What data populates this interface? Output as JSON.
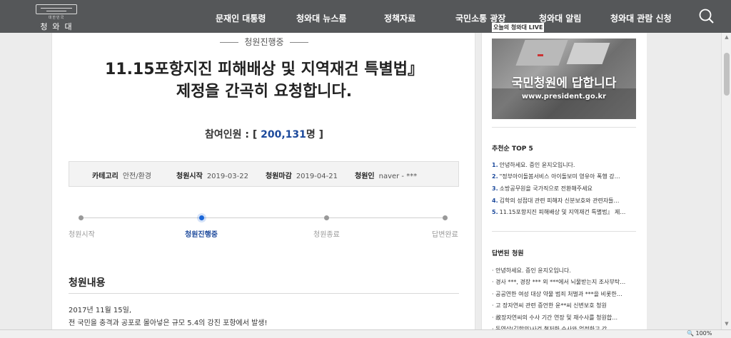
{
  "header": {
    "logo_sub": "대한민국",
    "logo_name": "청와대",
    "nav": [
      "문재인 대통령",
      "청와대 뉴스룸",
      "정책자료",
      "국민소통 광장",
      "청와대 알림",
      "청와대 관람 신청"
    ]
  },
  "petition": {
    "status": "청원진행중",
    "title_line1": "11.15포항지진 피해배상 및 지역재건 특별법』",
    "title_line2": "제정을 간곡히 요청합니다.",
    "participants_label": "참여인원 : [ ",
    "participants_count": "200,131",
    "participants_suffix": "명 ]",
    "info": {
      "category_label": "카테고리",
      "category_value": "안전/환경",
      "start_label": "청원시작",
      "start_value": "2019-03-22",
      "end_label": "청원마감",
      "end_value": "2019-04-21",
      "author_label": "청원인",
      "author_value": "naver - ***"
    },
    "steps": [
      "청원시작",
      "청원진행중",
      "청원종료",
      "답변완료"
    ],
    "active_step": 1,
    "content_heading": "청원내용",
    "content_lines": [
      "2017년 11월 15일,",
      "전 국민을 충격과 공포로 몰아넣은 규모 5.4의 강진 포항에서 발생!"
    ]
  },
  "sidebar": {
    "live_label": "오늘의 청와대 LIVE",
    "banner_headline": "국민청원에 답합니다",
    "banner_url": "www.president.go.kr",
    "top5_heading": "추천순 TOP 5",
    "top5": [
      {
        "num": "1.",
        "text": "안녕하세요. 증인 윤지오입니다."
      },
      {
        "num": "2.",
        "text": "\"정부아이돌봄서비스 아이돌보미 영유아 폭행 강…"
      },
      {
        "num": "3.",
        "text": "소방공무원을 국가직으로 전환해주세요"
      },
      {
        "num": "4.",
        "text": "김학의 성접대 관련 피해자 신분보호와 관련자들…"
      },
      {
        "num": "5.",
        "text": "11.15포항지진 피해배상 및 지역재건 특별법』 제…"
      }
    ],
    "answered_heading": "답변된 청원",
    "answered": [
      "· 안녕하세요. 증인 윤지오입니다.",
      "· 경사 ***, 경장 *** 외 ***에서 뇌물받는지 조사부탁…",
      "· 공공연한 여성 대상 약물 범죄 처벌과 ***을 비롯한…",
      "· 고 장자연씨 관련 증언한 윤**씨 신변보호 청원",
      "· 故장자연씨의 수사 기간 연장 및 재수사를 청원합…",
      "· 동영상(김학의)사건 철저한 수사와 엄정한고 강…"
    ]
  },
  "statusbar": {
    "zoom": "🔍 100%"
  },
  "colors": {
    "nav_bg": "#555759",
    "accent_blue": "#1d4a9c",
    "active_step": "#1a66d8"
  }
}
